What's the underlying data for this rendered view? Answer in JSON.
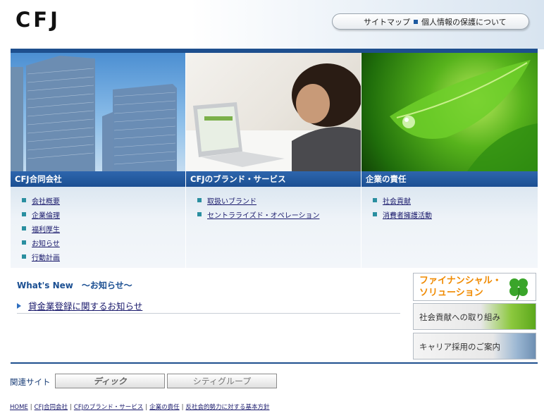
{
  "header": {
    "logo": "CFJ",
    "sitemap_label": "サイトマップ",
    "privacy_label": "個人情報の保護について"
  },
  "sections": [
    {
      "title": "CFJ合同会社",
      "links": [
        "会社概要",
        "企業倫理",
        "福利厚生",
        "お知らせ",
        "行動計画"
      ]
    },
    {
      "title": "CFJのブランド・サービス",
      "links": [
        "取扱いブランド",
        "セントラライズド・オペレーション"
      ]
    },
    {
      "title": "企業の責任",
      "links": [
        "社会貢献",
        "消費者擁護活動"
      ]
    }
  ],
  "news": {
    "title": "What's New　～お知らせ～",
    "items": [
      "貸金業登録に関するお知らせ"
    ]
  },
  "banners": {
    "financial_line1": "ファイナンシャル・",
    "financial_line2": "ソリューション",
    "social": "社会貢献への取り組み",
    "career": "キャリア採用のご案内"
  },
  "related": {
    "label": "関連サイト",
    "sites": [
      "ディック",
      "シティグループ"
    ]
  },
  "footer": {
    "links": [
      "HOME",
      "CFJ合同会社",
      "CFJのブランド・サービス",
      "企業の責任",
      "反社会的勢力に対する基本方針"
    ]
  },
  "colors": {
    "brand_blue": "#1e4f8e",
    "bullet_teal": "#2a8fa0",
    "banner_orange": "#f08a00"
  }
}
